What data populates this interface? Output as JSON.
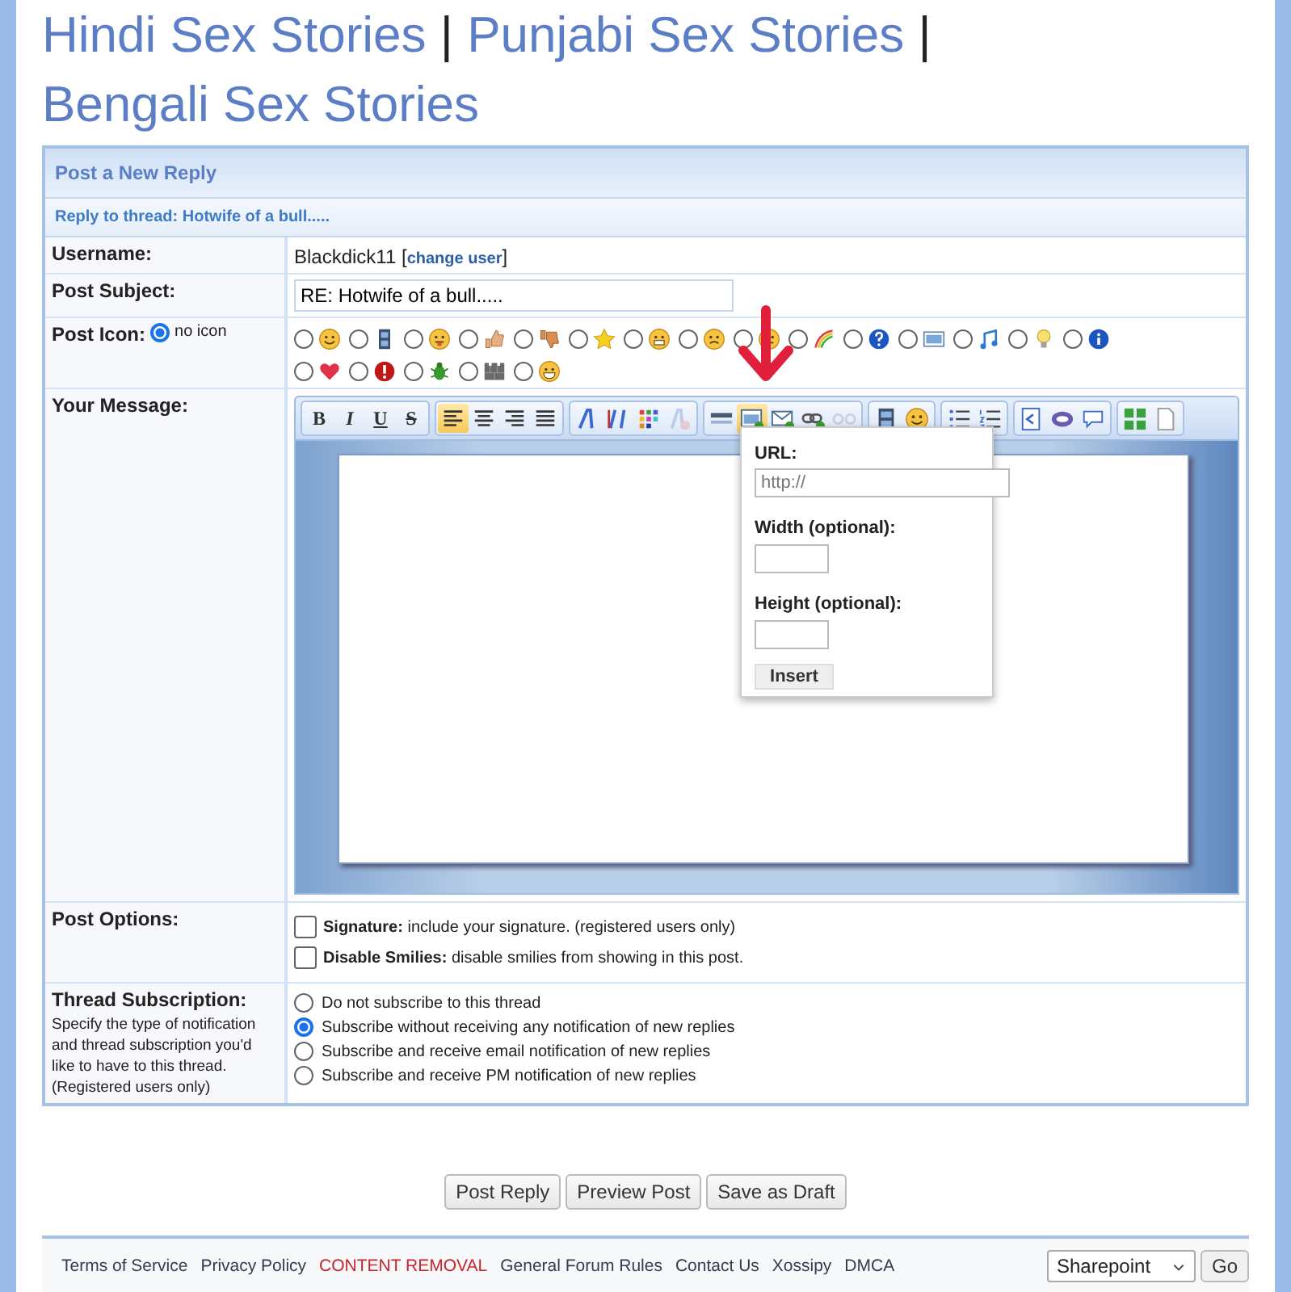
{
  "header": [
    {
      "kind": "link",
      "text": "Hindi Sex Stories"
    },
    {
      "kind": "separator",
      "text": "|"
    },
    {
      "kind": "link",
      "text": "Punjabi Sex Stories"
    },
    {
      "kind": "separator",
      "text": "|"
    },
    {
      "kind": "link",
      "text": "Bengali Sex Stories"
    }
  ],
  "form": {
    "title": "Post a New Reply",
    "subtitle": "Reply to thread: Hotwife of a bull.....",
    "username": {
      "label": "Username:",
      "value": "Blackdick11",
      "bracket_open": "[",
      "link": "change user",
      "bracket_close": "]"
    },
    "subject": {
      "label": "Post Subject:",
      "value": "RE: Hotwife of a bull....."
    },
    "post_icon": {
      "label": "Post Icon:",
      "no_icon": {
        "label": "no icon",
        "selected": true
      },
      "icons": [
        {
          "selected": false
        },
        {
          "selected": false
        },
        {
          "selected": false
        },
        {
          "selected": false
        },
        {
          "selected": false
        },
        {
          "selected": false
        },
        {
          "selected": false
        },
        {
          "selected": false
        },
        {
          "selected": false
        },
        {
          "selected": false
        },
        {
          "selected": false
        },
        {
          "selected": false
        },
        {
          "selected": false
        },
        {
          "selected": false
        },
        {
          "selected": false
        },
        {
          "selected": false
        },
        {
          "selected": false
        },
        {
          "selected": false
        },
        {
          "selected": false
        },
        {
          "selected": false
        }
      ]
    },
    "message": {
      "label": "Your Message:",
      "toolbar": [
        [
          {
            "kind": "text",
            "label": "B",
            "selected": false,
            "disabled": false
          },
          {
            "kind": "text",
            "label": "I",
            "selected": false,
            "disabled": false
          },
          {
            "kind": "text",
            "label": "U",
            "selected": false,
            "disabled": false
          },
          {
            "kind": "text",
            "label": "S",
            "selected": false,
            "disabled": false
          }
        ],
        [
          {
            "kind": "icon",
            "selected": true,
            "disabled": false
          },
          {
            "kind": "icon",
            "selected": false,
            "disabled": false
          },
          {
            "kind": "icon",
            "selected": false,
            "disabled": false
          },
          {
            "kind": "icon",
            "selected": false,
            "disabled": false
          }
        ],
        [
          {
            "kind": "icon",
            "selected": false,
            "disabled": false
          },
          {
            "kind": "icon",
            "selected": false,
            "disabled": false
          },
          {
            "kind": "icon",
            "selected": false,
            "disabled": false
          },
          {
            "kind": "icon",
            "selected": false,
            "disabled": true
          }
        ],
        [
          {
            "kind": "icon",
            "selected": false,
            "disabled": false
          },
          {
            "kind": "icon",
            "selected": true,
            "disabled": false
          },
          {
            "kind": "icon",
            "selected": false,
            "disabled": false
          },
          {
            "kind": "icon",
            "selected": false,
            "disabled": false
          },
          {
            "kind": "icon",
            "selected": false,
            "disabled": true
          }
        ],
        [
          {
            "kind": "icon",
            "selected": false,
            "disabled": false
          },
          {
            "kind": "icon",
            "selected": false,
            "disabled": false
          }
        ],
        [
          {
            "kind": "icon",
            "selected": false,
            "disabled": false
          },
          {
            "kind": "icon",
            "selected": false,
            "disabled": false
          }
        ],
        [
          {
            "kind": "icon",
            "selected": false,
            "disabled": false
          },
          {
            "kind": "icon",
            "selected": false,
            "disabled": false
          },
          {
            "kind": "icon",
            "selected": false,
            "disabled": false
          }
        ],
        [
          {
            "kind": "icon",
            "selected": false,
            "disabled": false
          },
          {
            "kind": "icon",
            "selected": false,
            "disabled": false
          }
        ]
      ],
      "popup": {
        "url_label": "URL:",
        "url_placeholder": "http://",
        "width_label": "Width (optional):",
        "height_label": "Height (optional):",
        "button": "Insert"
      }
    },
    "options": {
      "label": "Post Options:",
      "items": [
        {
          "text": "**Signature:** include your signature. (registered users only)",
          "checked": false
        },
        {
          "text": "**Disable Smilies:** disable smilies from showing in this post.",
          "checked": false
        }
      ]
    },
    "subscription": {
      "label": "Thread Subscription:",
      "description": "Specify the type of notification and thread subscription you'd like to have to this thread. (Registered users only)",
      "choices": [
        {
          "label": "Do not subscribe to this thread",
          "selected": false
        },
        {
          "label": "Subscribe without receiving any notification of new replies",
          "selected": true
        },
        {
          "label": "Subscribe and receive email notification of new replies",
          "selected": false
        },
        {
          "label": "Subscribe and receive PM notification of new replies",
          "selected": false
        }
      ]
    }
  },
  "buttons": [
    "Post Reply",
    "Preview Post",
    "Save as Draft"
  ],
  "footer": {
    "links": [
      {
        "text": "Terms of Service",
        "color": "#333d4f"
      },
      {
        "text": "Privacy Policy",
        "color": "#333d4f"
      },
      {
        "text": "CONTENT REMOVAL",
        "color": "#c8262c"
      },
      {
        "text": "General Forum Rules",
        "color": "#333d4f"
      },
      {
        "text": "Contact Us",
        "color": "#333d4f"
      },
      {
        "text": "Xossipy",
        "color": "#333d4f"
      },
      {
        "text": "DMCA",
        "color": "#333d4f"
      }
    ],
    "style_select": "Sharepoint",
    "go": "Go"
  }
}
